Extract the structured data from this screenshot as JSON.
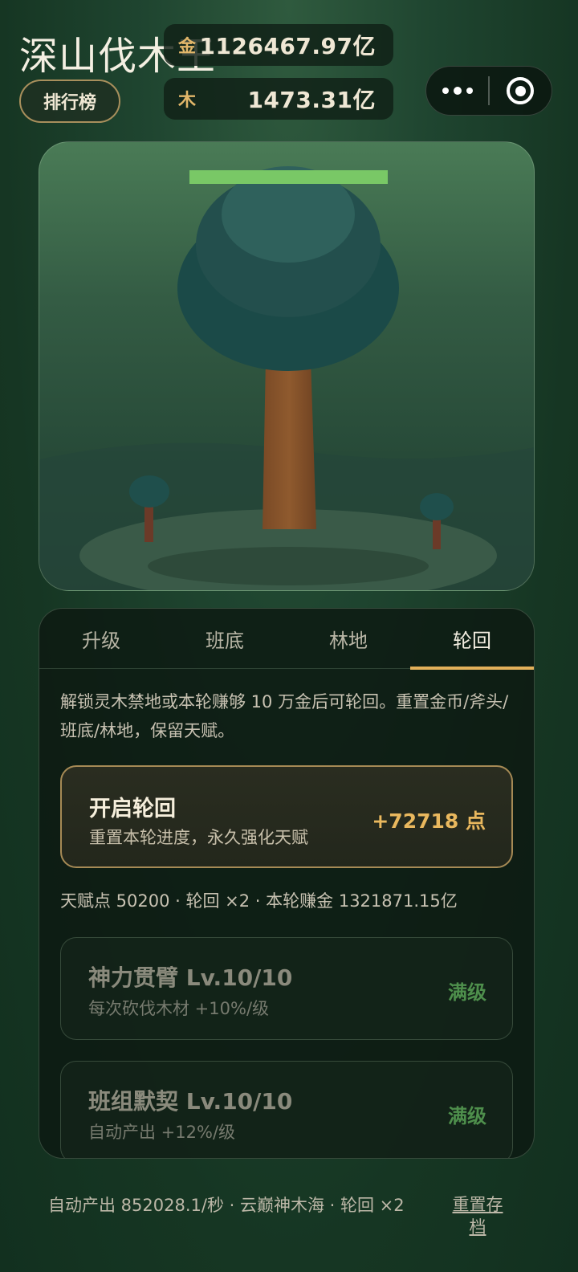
{
  "header": {
    "title": "深山伐木王",
    "rank_label": "排行榜"
  },
  "resources": {
    "gold": {
      "icon": "金",
      "value": "1126467.97亿"
    },
    "wood": {
      "icon": "木",
      "value": "1473.31亿"
    }
  },
  "capsule": {
    "more_icon": "more-dots-icon",
    "close_icon": "target-icon"
  },
  "scene": {
    "tree_hp_fraction": 1.0
  },
  "tabs": [
    {
      "label": "升级",
      "active": false
    },
    {
      "label": "班底",
      "active": false
    },
    {
      "label": "林地",
      "active": false
    },
    {
      "label": "轮回",
      "active": true
    }
  ],
  "rebirth_panel": {
    "description": "解锁灵木禁地或本轮赚够 10 万金后可轮回。重置金币/斧头/班底/林地，保留天赋。",
    "card": {
      "title": "开启轮回",
      "subtitle": "重置本轮进度，永久强化天赋",
      "points": "+72718 点"
    },
    "stats": "天赋点 50200 · 轮回 ×2 · 本轮赚金 1321871.15亿",
    "talents": [
      {
        "name": "神力贯臂 Lv.10/10",
        "desc": "每次砍伐木材 +10%/级",
        "status": "满级"
      },
      {
        "name": "班组默契 Lv.10/10",
        "desc": "自动产出 +12%/级",
        "status": "满级"
      }
    ]
  },
  "footer": {
    "status": "自动产出 852028.1/秒 · 云巅神木海 · 轮回 ×2",
    "reset_label": "重置存档"
  },
  "colors": {
    "accent_gold": "#e2b05a",
    "hp_green": "#79c866",
    "max_level_green": "#4e8f4c",
    "bg_green": "#1f4530"
  }
}
